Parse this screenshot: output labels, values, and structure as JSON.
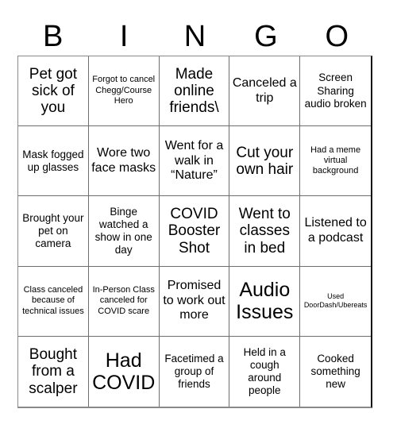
{
  "card": {
    "title": "BINGO",
    "header_letters": [
      "B",
      "I",
      "N",
      "G",
      "O"
    ],
    "columns": 5,
    "rows": 5,
    "background_color": "#ffffff",
    "text_color": "#000000",
    "grid_line_color": "#6e6e6e"
  },
  "cells": [
    {
      "text": "Pet got sick of you",
      "size": "xl"
    },
    {
      "text": "Forgot to cancel Chegg/Course Hero",
      "size": "sm"
    },
    {
      "text": "Made online friends\\",
      "size": "xl"
    },
    {
      "text": "Canceled a trip",
      "size": "lg"
    },
    {
      "text": "Screen Sharing audio broken",
      "size": "md"
    },
    {
      "text": "Mask fogged up glasses",
      "size": "md"
    },
    {
      "text": "Wore two face masks",
      "size": "lg"
    },
    {
      "text": "Went for a walk in “Nature”",
      "size": "lg"
    },
    {
      "text": "Cut your own hair",
      "size": "xl"
    },
    {
      "text": "Had a meme virtual background",
      "size": "sm"
    },
    {
      "text": "Brought your pet on camera",
      "size": "md"
    },
    {
      "text": "Binge watched a show in one day",
      "size": "md"
    },
    {
      "text": "COVID Booster Shot",
      "size": "xl"
    },
    {
      "text": "Went to classes in bed",
      "size": "xl"
    },
    {
      "text": "Listened to a podcast",
      "size": "lg"
    },
    {
      "text": "Class canceled because of technical issues",
      "size": "sm"
    },
    {
      "text": "In-Person Class canceled for COVID scare",
      "size": "sm"
    },
    {
      "text": "Promised to work out more",
      "size": "lg"
    },
    {
      "text": "Audio Issues",
      "size": "xxl"
    },
    {
      "text": "Used DoorDash/Ubereats",
      "size": "xs"
    },
    {
      "text": "Bought from a scalper",
      "size": "xl"
    },
    {
      "text": "Had COVID",
      "size": "xxl"
    },
    {
      "text": "Facetimed a group of friends",
      "size": "md"
    },
    {
      "text": "Held in a cough around people",
      "size": "md"
    },
    {
      "text": "Cooked something new",
      "size": "md"
    }
  ]
}
